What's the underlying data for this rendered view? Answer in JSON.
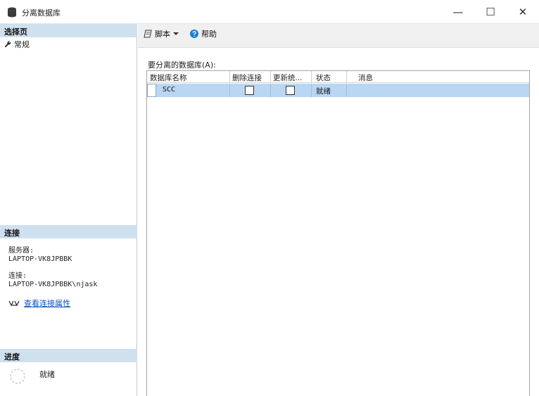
{
  "window": {
    "title": "分离数据库",
    "minimize_label": "—",
    "maximize_label": "☐",
    "close_label": "✕"
  },
  "left_panel": {
    "select_page_header": "选择页",
    "pages": [
      {
        "label": "常规",
        "icon": "wrench-icon"
      }
    ],
    "connection_header": "连接",
    "server_label": "服务器:",
    "server_value": "LAPTOP-VK8JPBBK",
    "connection_label": "连接:",
    "connection_value": "LAPTOP-VK8JPBBK\\njask",
    "view_connection_properties": "查看连接属性",
    "progress_header": "进度",
    "progress_status": "就绪"
  },
  "toolbar": {
    "script_label": "脚本",
    "help_label": "帮助"
  },
  "grid": {
    "label": "要分离的数据库(A):",
    "columns": [
      "数据库名称",
      "删除连接",
      "更新统...",
      "状态",
      "消息"
    ],
    "rows": [
      {
        "database_name": "SCC",
        "drop_connections": false,
        "update_statistics": false,
        "status": "就绪",
        "message": ""
      }
    ]
  },
  "colors": {
    "section_header_bg": "#cfe0ef",
    "selected_row_bg": "#b9d7f3",
    "link": "#0b55c4",
    "toolbar_bg": "#f0f0f0"
  }
}
